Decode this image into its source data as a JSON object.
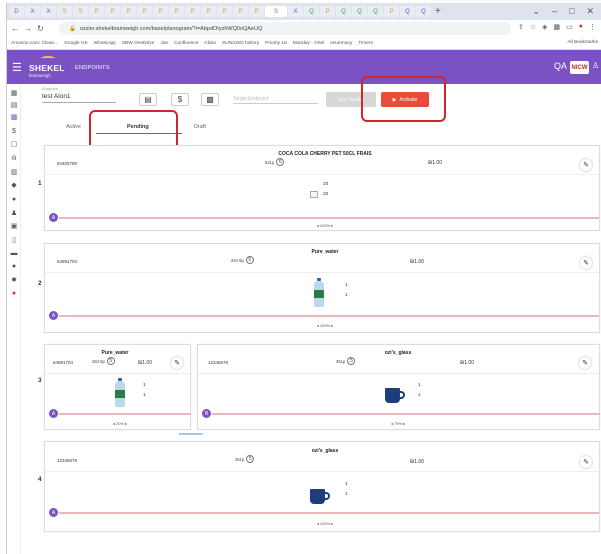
{
  "browser": {
    "tabs": [
      "D",
      "X",
      "X",
      "S",
      "S",
      "P",
      "P",
      "P",
      "P",
      "P",
      "P",
      "P",
      "P",
      "P",
      "P",
      "P",
      "S",
      "X",
      "Q",
      "P",
      "Q",
      "Q",
      "Q",
      "P",
      "Q",
      "Q"
    ],
    "new_tab": "+",
    "url": "ozzier.shekelbrainweigh.com/base/planogram/?i=AbpdOIyzhWQ0oQAeUQ",
    "bookmarks": [
      "Amazon.com: Clean...",
      "Google UK",
      "WhatsApp",
      "SBW OneDrive",
      "Joe",
      "Confluence",
      "Clisio",
      "SUN/USD history",
      "Priority 18",
      "Monday - Oriel",
      "eHarmony",
      "Timers"
    ],
    "all_bookmarks": "All Bookmarks"
  },
  "header": {
    "logo_name": "SHEKEL",
    "logo_sub": "brainweigh",
    "section": "ENDPOINTS",
    "env_label": "QA",
    "brand_badge": "NICW"
  },
  "toolbar": {
    "endpoint_label": "Endpoint",
    "endpoint_value": "test Alon1",
    "target_placeholder": "Target Endpoint",
    "gray_button": "Sign Parallel",
    "activate_button": "Activate"
  },
  "tabs": {
    "active": "Active",
    "pending": "Pending",
    "draft": "Draft"
  },
  "shelves": [
    {
      "row": "1",
      "title": "COCA COLA CHERRY PET 50CL FRAIS",
      "code": "54402790",
      "count": "541p",
      "count_badge": "6",
      "price": "₪1.00",
      "facings": [
        "20",
        "20"
      ],
      "zoom": "◂ 100% ▸",
      "badge": "A"
    },
    {
      "row": "2",
      "title": "Pure_water",
      "code": "64991704",
      "count": "264 8p",
      "count_badge": "5",
      "price": "₪1.00",
      "facings": [
        "1",
        "1"
      ],
      "zoom": "◂ 100% ▸",
      "badge": "A"
    },
    {
      "row": "3",
      "left": {
        "title": "Pure_water",
        "code": "64991704",
        "count": "264 8p",
        "count_badge": "5",
        "price": "₪1.00",
        "facings": [
          "1",
          "1"
        ],
        "zoom": "◂ 20% ▸",
        "badge": "A"
      },
      "right": {
        "title": "ozi's_glass",
        "code": "12345678",
        "count": "351p",
        "count_badge": "5",
        "price": "₪1.00",
        "facings": [
          "1",
          "1"
        ],
        "zoom": "◂ 79% ▸",
        "badge": "B"
      }
    },
    {
      "row": "4",
      "title": "ozi's_glass",
      "code": "12345678",
      "count": "351p",
      "count_badge": "5",
      "price": "₪1.00",
      "facings": [
        "1",
        "1"
      ],
      "zoom": "◂ 100% ▸",
      "badge": "A"
    }
  ],
  "colors": {
    "header": "#7b52c4",
    "activate": "#e84d3c",
    "highlight": "#d0272f",
    "pink_bar": "#e9b8bd"
  }
}
